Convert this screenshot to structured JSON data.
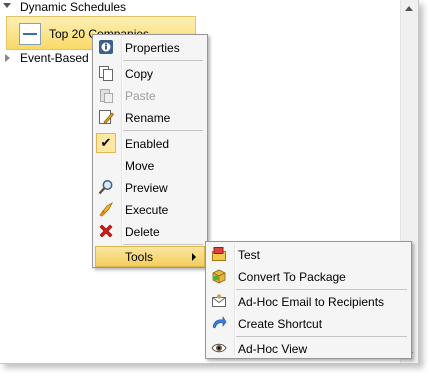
{
  "tree": {
    "dynamic_schedules": "Dynamic Schedules",
    "selected_node": "Top 20 Companies",
    "event_based": "Event-Based S"
  },
  "context_menu": {
    "items": [
      {
        "label": "Properties",
        "icon": "properties-icon",
        "enabled": true
      },
      {
        "label": "Copy",
        "icon": "copy-icon",
        "enabled": true
      },
      {
        "label": "Paste",
        "icon": "paste-icon",
        "enabled": false
      },
      {
        "label": "Rename",
        "icon": "rename-icon",
        "enabled": true
      },
      {
        "label": "Enabled",
        "icon": "checkmark-icon",
        "enabled": true,
        "checked": true
      },
      {
        "label": "Move",
        "icon": "",
        "enabled": true
      },
      {
        "label": "Preview",
        "icon": "magnifier-icon",
        "enabled": true
      },
      {
        "label": "Execute",
        "icon": "execute-icon",
        "enabled": true
      },
      {
        "label": "Delete",
        "icon": "delete-icon",
        "enabled": true
      },
      {
        "label": "Tools",
        "icon": "",
        "enabled": true,
        "highlighted": true
      }
    ]
  },
  "tools_submenu": {
    "items": [
      {
        "label": "Test",
        "icon": "test-icon"
      },
      {
        "label": "Convert To Package",
        "icon": "package-icon"
      },
      {
        "label": "Ad-Hoc Email to Recipients",
        "icon": "email-icon"
      },
      {
        "label": "Create Shortcut",
        "icon": "shortcut-icon"
      },
      {
        "label": "Ad-Hoc View",
        "icon": "eye-icon"
      }
    ]
  },
  "colors": {
    "highlight_top": "#fbe6a0",
    "highlight_bottom": "#f4cd5d",
    "selection_top": "#fdf0b6",
    "selection_bottom": "#f9d967"
  }
}
